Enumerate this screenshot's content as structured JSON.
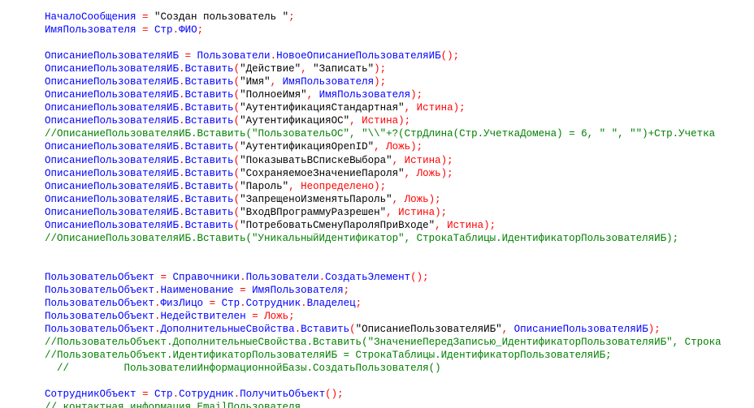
{
  "editor": {
    "colors": {
      "identifier": "#0000ff",
      "operator": "#ff0000",
      "keyword": "#ff0000",
      "string": "#000000",
      "comment": "#008000"
    },
    "lines": [
      [
        [
          "i",
          "НачалоСообщения"
        ],
        [
          "o",
          " = "
        ],
        [
          "s",
          "\"Создан пользователь \""
        ],
        [
          "o",
          ";"
        ]
      ],
      [
        [
          "i",
          "ИмяПользователя"
        ],
        [
          "o",
          " = "
        ],
        [
          "i",
          "Стр"
        ],
        [
          "o",
          "."
        ],
        [
          "i",
          "ФИО"
        ],
        [
          "o",
          ";"
        ]
      ],
      [],
      [
        [
          "i",
          "ОписаниеПользователяИБ"
        ],
        [
          "o",
          " = "
        ],
        [
          "i",
          "Пользователи"
        ],
        [
          "o",
          "."
        ],
        [
          "i",
          "НовоеОписаниеПользователяИБ"
        ],
        [
          "o",
          "();"
        ]
      ],
      [
        [
          "i",
          "ОписаниеПользователяИБ"
        ],
        [
          "o",
          "."
        ],
        [
          "i",
          "Вставить"
        ],
        [
          "o",
          "("
        ],
        [
          "s",
          "\"Действие\""
        ],
        [
          "o",
          ", "
        ],
        [
          "s",
          "\"Записать\""
        ],
        [
          "o",
          ");"
        ]
      ],
      [
        [
          "i",
          "ОписаниеПользователяИБ"
        ],
        [
          "o",
          "."
        ],
        [
          "i",
          "Вставить"
        ],
        [
          "o",
          "("
        ],
        [
          "s",
          "\"Имя\""
        ],
        [
          "o",
          ", "
        ],
        [
          "i",
          "ИмяПользователя"
        ],
        [
          "o",
          ");"
        ]
      ],
      [
        [
          "i",
          "ОписаниеПользователяИБ"
        ],
        [
          "o",
          "."
        ],
        [
          "i",
          "Вставить"
        ],
        [
          "o",
          "("
        ],
        [
          "s",
          "\"ПолноеИмя\""
        ],
        [
          "o",
          ", "
        ],
        [
          "i",
          "ИмяПользователя"
        ],
        [
          "o",
          ");"
        ]
      ],
      [
        [
          "i",
          "ОписаниеПользователяИБ"
        ],
        [
          "o",
          "."
        ],
        [
          "i",
          "Вставить"
        ],
        [
          "o",
          "("
        ],
        [
          "s",
          "\"АутентификацияСтандартная\""
        ],
        [
          "o",
          ", "
        ],
        [
          "k",
          "Истина"
        ],
        [
          "o",
          ");"
        ]
      ],
      [
        [
          "i",
          "ОписаниеПользователяИБ"
        ],
        [
          "o",
          "."
        ],
        [
          "i",
          "Вставить"
        ],
        [
          "o",
          "("
        ],
        [
          "s",
          "\"АутентификацияОС\""
        ],
        [
          "o",
          ", "
        ],
        [
          "k",
          "Истина"
        ],
        [
          "o",
          ");"
        ]
      ],
      [
        [
          "c",
          "//ОписаниеПользователяИБ.Вставить(\"ПользовательОС\", \"\\\\\"+?(СтрДлина(Стр.УчеткаДомена) = 6, \" \", \"\")+Стр.Учетка"
        ]
      ],
      [
        [
          "i",
          "ОписаниеПользователяИБ"
        ],
        [
          "o",
          "."
        ],
        [
          "i",
          "Вставить"
        ],
        [
          "o",
          "("
        ],
        [
          "s",
          "\"АутентификацияOpenID\""
        ],
        [
          "o",
          ", "
        ],
        [
          "k",
          "Ложь"
        ],
        [
          "o",
          ");"
        ]
      ],
      [
        [
          "i",
          "ОписаниеПользователяИБ"
        ],
        [
          "o",
          "."
        ],
        [
          "i",
          "Вставить"
        ],
        [
          "o",
          "("
        ],
        [
          "s",
          "\"ПоказыватьВСпискеВыбора\""
        ],
        [
          "o",
          ", "
        ],
        [
          "k",
          "Истина"
        ],
        [
          "o",
          ");"
        ]
      ],
      [
        [
          "i",
          "ОписаниеПользователяИБ"
        ],
        [
          "o",
          "."
        ],
        [
          "i",
          "Вставить"
        ],
        [
          "o",
          "("
        ],
        [
          "s",
          "\"СохраняемоеЗначениеПароля\""
        ],
        [
          "o",
          ", "
        ],
        [
          "k",
          "Ложь"
        ],
        [
          "o",
          ");"
        ]
      ],
      [
        [
          "i",
          "ОписаниеПользователяИБ"
        ],
        [
          "o",
          "."
        ],
        [
          "i",
          "Вставить"
        ],
        [
          "o",
          "("
        ],
        [
          "s",
          "\"Пароль\""
        ],
        [
          "o",
          ", "
        ],
        [
          "k",
          "Неопределено"
        ],
        [
          "o",
          ");"
        ]
      ],
      [
        [
          "i",
          "ОписаниеПользователяИБ"
        ],
        [
          "o",
          "."
        ],
        [
          "i",
          "Вставить"
        ],
        [
          "o",
          "("
        ],
        [
          "s",
          "\"ЗапрещеноИзменятьПароль\""
        ],
        [
          "o",
          ", "
        ],
        [
          "k",
          "Ложь"
        ],
        [
          "o",
          ");"
        ]
      ],
      [
        [
          "i",
          "ОписаниеПользователяИБ"
        ],
        [
          "o",
          "."
        ],
        [
          "i",
          "Вставить"
        ],
        [
          "o",
          "("
        ],
        [
          "s",
          "\"ВходВПрограммуРазрешен\""
        ],
        [
          "o",
          ", "
        ],
        [
          "k",
          "Истина"
        ],
        [
          "o",
          ");"
        ]
      ],
      [
        [
          "i",
          "ОписаниеПользователяИБ"
        ],
        [
          "o",
          "."
        ],
        [
          "i",
          "Вставить"
        ],
        [
          "o",
          "("
        ],
        [
          "s",
          "\"ПотребоватьСменуПароляПриВходе\""
        ],
        [
          "o",
          ", "
        ],
        [
          "k",
          "Истина"
        ],
        [
          "o",
          ");"
        ]
      ],
      [
        [
          "c",
          "//ОписаниеПользователяИБ.Вставить(\"УникальныйИдентификатор\", СтрокаТаблицы.ИдентификаторПользователяИБ);"
        ]
      ],
      [],
      [],
      [
        [
          "i",
          "ПользовательОбъект"
        ],
        [
          "o",
          " = "
        ],
        [
          "i",
          "Справочники"
        ],
        [
          "o",
          "."
        ],
        [
          "i",
          "Пользователи"
        ],
        [
          "o",
          "."
        ],
        [
          "i",
          "СоздатьЭлемент"
        ],
        [
          "o",
          "();"
        ]
      ],
      [
        [
          "i",
          "ПользовательОбъект"
        ],
        [
          "o",
          "."
        ],
        [
          "i",
          "Наименование"
        ],
        [
          "o",
          " = "
        ],
        [
          "i",
          "ИмяПользователя"
        ],
        [
          "o",
          ";"
        ]
      ],
      [
        [
          "i",
          "ПользовательОбъект"
        ],
        [
          "o",
          "."
        ],
        [
          "i",
          "ФизЛицо"
        ],
        [
          "o",
          " = "
        ],
        [
          "i",
          "Стр"
        ],
        [
          "o",
          "."
        ],
        [
          "i",
          "Сотрудник"
        ],
        [
          "o",
          "."
        ],
        [
          "i",
          "Владелец"
        ],
        [
          "o",
          ";"
        ]
      ],
      [
        [
          "i",
          "ПользовательОбъект"
        ],
        [
          "o",
          "."
        ],
        [
          "i",
          "Недействителен"
        ],
        [
          "o",
          " = "
        ],
        [
          "k",
          "Ложь"
        ],
        [
          "o",
          ";"
        ]
      ],
      [
        [
          "i",
          "ПользовательОбъект"
        ],
        [
          "o",
          "."
        ],
        [
          "i",
          "ДополнительныеСвойства"
        ],
        [
          "o",
          "."
        ],
        [
          "i",
          "Вставить"
        ],
        [
          "o",
          "("
        ],
        [
          "s",
          "\"ОписаниеПользователяИБ\""
        ],
        [
          "o",
          ", "
        ],
        [
          "i",
          "ОписаниеПользователяИБ"
        ],
        [
          "o",
          ");"
        ]
      ],
      [
        [
          "c",
          "//ПользовательОбъект.ДополнительныеСвойства.Вставить(\"ЗначениеПередЗаписью_ИдентификаторПользователяИБ\", Строка"
        ]
      ],
      [
        [
          "c",
          "//ПользовательОбъект.ИдентификаторПользователяИБ = СтрокаТаблицы.ИдентификаторПользователяИБ;"
        ]
      ],
      [
        [
          "c",
          "  //         ПользователиИнформационнойБазы.СоздатьПользователя()"
        ]
      ],
      [],
      [
        [
          "i",
          "СотрудникОбъект"
        ],
        [
          "o",
          " = "
        ],
        [
          "i",
          "Стр"
        ],
        [
          "o",
          "."
        ],
        [
          "i",
          "Сотрудник"
        ],
        [
          "o",
          "."
        ],
        [
          "i",
          "ПолучитьОбъект"
        ],
        [
          "o",
          "();"
        ]
      ],
      [
        [
          "c",
          "// контактная информация EmailПользователя"
        ]
      ]
    ]
  }
}
